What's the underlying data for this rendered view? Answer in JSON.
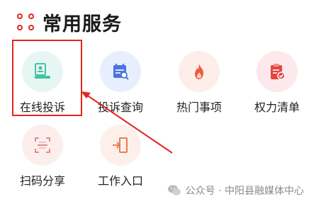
{
  "section": {
    "title": "常用服务"
  },
  "services": [
    {
      "label": "在线投诉",
      "icon": "complaint-id-card-icon",
      "bg": "#e6f7f3",
      "color": "#42c3a4"
    },
    {
      "label": "投诉查询",
      "icon": "complaint-query-calendar-icon",
      "bg": "#e9eefc",
      "color": "#4d74e4"
    },
    {
      "label": "热门事项",
      "icon": "hot-flame-icon",
      "bg": "#fdeeea",
      "color": "#ef5a3c"
    },
    {
      "label": "权力清单",
      "icon": "power-list-clipboard-icon",
      "bg": "#fde9eb",
      "color": "#e5453f"
    },
    {
      "label": "扫码分享",
      "icon": "scan-qr-icon",
      "bg": "#fdeeee",
      "color": "#e58b8b"
    },
    {
      "label": "工作入口",
      "icon": "work-entrance-door-icon",
      "bg": "#fdf0ea",
      "color": "#ef7b4f"
    }
  ],
  "watermark": {
    "text": "公众号 · 中阳县融媒体中心"
  },
  "accent": "#e2271f"
}
